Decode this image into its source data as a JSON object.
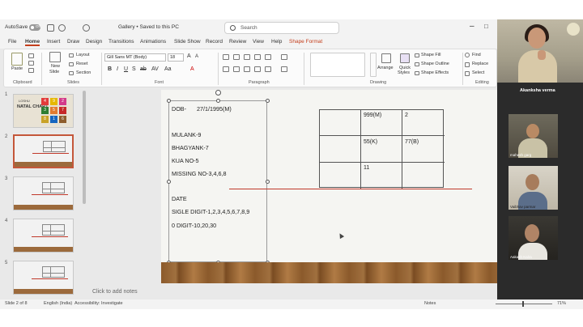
{
  "window": {
    "autosave_label": "AutoSave",
    "toggle_state": "Off",
    "doc_title": "Gallery • Saved to this PC",
    "search_placeholder": "Search"
  },
  "menu": {
    "items": [
      "File",
      "Home",
      "Insert",
      "Draw",
      "Design",
      "Transitions",
      "Animations",
      "Slide Show",
      "Record",
      "Review",
      "View",
      "Help",
      "Shape Format"
    ],
    "active": "Home"
  },
  "ribbon": {
    "clipboard": {
      "paste": "Paste",
      "group": "Clipboard"
    },
    "slides": {
      "new_slide": "New",
      "new_slide2": "Slide",
      "layout": "Layout",
      "reset": "Reset",
      "section": "Section",
      "group": "Slides"
    },
    "font": {
      "family": "Gill Sans MT (Body)",
      "size": "18",
      "group": "Font"
    },
    "paragraph": {
      "group": "Paragraph"
    },
    "drawing": {
      "arrange": "Arrange",
      "quick_styles": "Quick",
      "quick_styles2": "Styles",
      "shape_fill": "Shape Fill",
      "shape_outline": "Shape Outline",
      "shape_effects": "Shape Effects",
      "group": "Drawing"
    },
    "editing": {
      "find": "Find",
      "replace": "Replace",
      "select": "Select",
      "group": "Editing"
    }
  },
  "thumbnails": {
    "numbers": [
      "1",
      "2",
      "3",
      "4",
      "5"
    ],
    "slide1_title": "NATAL CHART",
    "slide1_caption": "LOSHU",
    "slide1_squares": [
      "4",
      "9",
      "2",
      "3",
      "5",
      "7",
      "8",
      "1",
      "6"
    ]
  },
  "slide": {
    "dob_label": "DOB-",
    "dob_value": "27/1/1995(M)",
    "mulank": "MULANK-9",
    "bhagyank": "BHAGYANK-7",
    "kua": "KUA NO-5",
    "missing": "MISSING NO-3,4,6,8",
    "date": "DATE",
    "single_digit": "SIGLE DIGIT-1,2,3,4,5,6,7,8,9",
    "zero_digit": "0 DIGIT-10,20,30",
    "grid": {
      "rows": [
        [
          "",
          "999(M)",
          "2"
        ],
        [
          "",
          "55(K)",
          "77(B)"
        ],
        [
          "",
          "11",
          ""
        ]
      ]
    }
  },
  "notes_placeholder": "Click to add notes",
  "status": {
    "slide_of": "Slide 2 of 8",
    "language": "English (India)",
    "accessibility": "Accessibility: Investigate",
    "notes": "Notes",
    "zoom": "71%"
  },
  "participants": {
    "presenter": "Akanksha verma",
    "tiles": [
      "mahesh garg",
      "Vaibhav parmar",
      "Aakash Kalra"
    ]
  },
  "colors": {
    "accent": "#c43e1c",
    "red_line": "#c0392b",
    "wood": "#8b5a2b"
  }
}
